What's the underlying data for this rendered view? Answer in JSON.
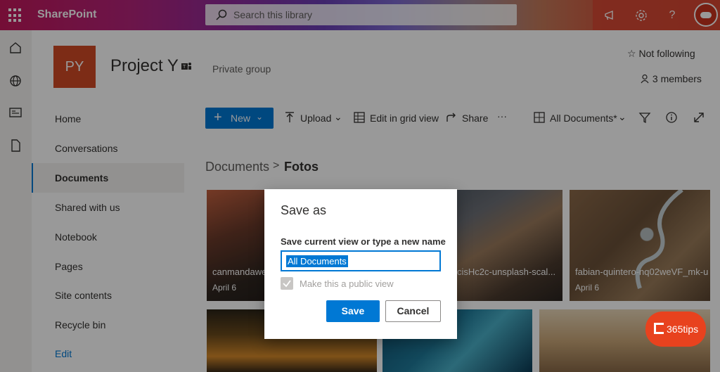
{
  "suite": {
    "app_name": "SharePoint",
    "search_placeholder": "Search this library"
  },
  "site": {
    "logo_initials": "PY",
    "title": "Project Y",
    "privacy": "Private group",
    "following": "Not following",
    "members": "3 members"
  },
  "nav": {
    "items": [
      {
        "label": "Home"
      },
      {
        "label": "Conversations"
      },
      {
        "label": "Documents"
      },
      {
        "label": "Shared with us"
      },
      {
        "label": "Notebook"
      },
      {
        "label": "Pages"
      },
      {
        "label": "Site contents"
      },
      {
        "label": "Recycle bin"
      },
      {
        "label": "Edit"
      }
    ],
    "active": "Documents"
  },
  "commands": {
    "new": "New",
    "upload": "Upload",
    "edit_grid": "Edit in grid view",
    "share": "Share",
    "more": "···",
    "view": "All Documents*"
  },
  "breadcrumb": {
    "parent": "Documents",
    "separator": ">",
    "current": "Fotos"
  },
  "tiles": [
    {
      "name": "canmandawe",
      "date": "April 6"
    },
    {
      "name": "cisHc2c-unsplash-scal...",
      "date": ""
    },
    {
      "name": "fabian-quintero-nq02weVF_mk-u",
      "date": "April 6"
    }
  ],
  "dialog": {
    "title": "Save as",
    "label": "Save current view or type a new name",
    "input_value": "All Documents",
    "checkbox_label": "Make this a public view",
    "checkbox_checked": true,
    "save": "Save",
    "cancel": "Cancel"
  },
  "badge": {
    "text": "365tips"
  },
  "colors": {
    "accent": "#0078d4",
    "logo": "#d04a26",
    "badge": "#e8421e"
  }
}
